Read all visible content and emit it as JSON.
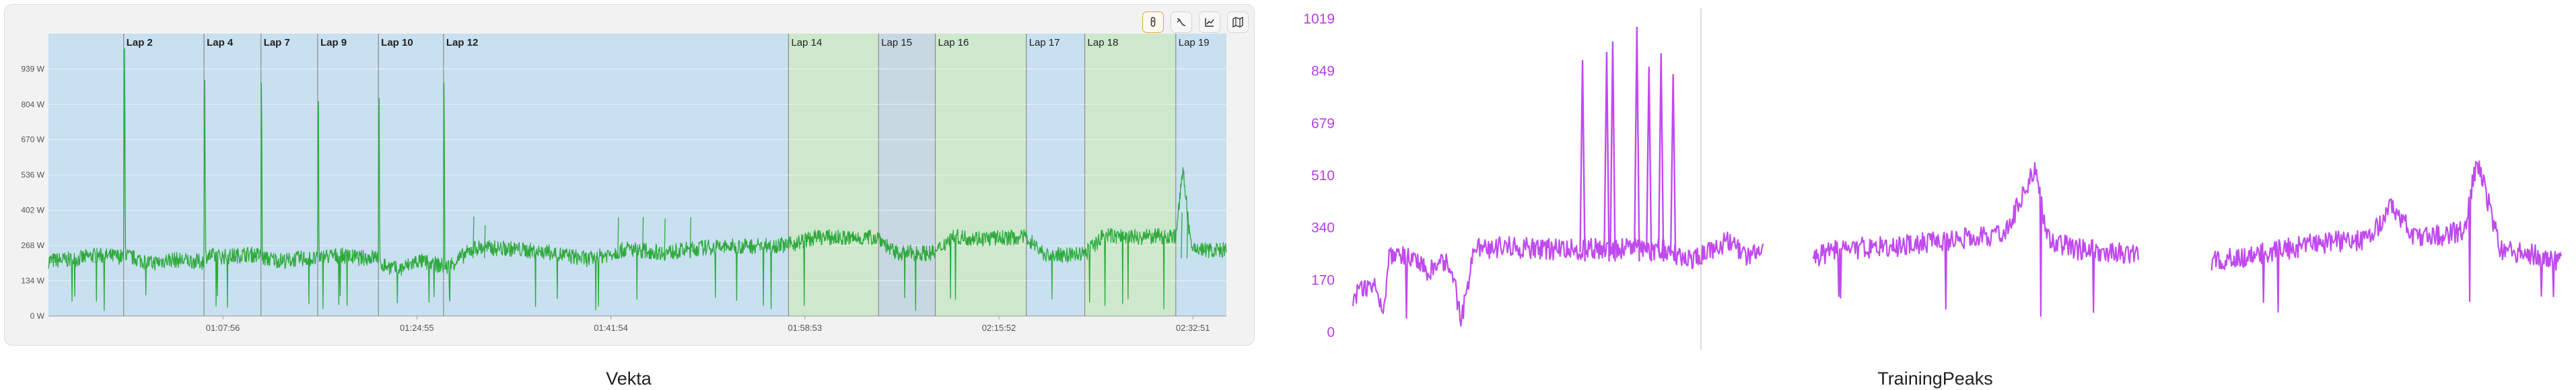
{
  "toolbar": {
    "buttons": [
      {
        "icon": "stopwatch-icon",
        "active": true
      },
      {
        "icon": "curve-icon",
        "active": false
      },
      {
        "icon": "line-chart-icon",
        "active": false
      },
      {
        "icon": "map-icon",
        "active": false
      }
    ]
  },
  "captions": {
    "vekta": "Vekta",
    "trainingpeaks": "TrainingPeaks"
  },
  "chart_data": [
    {
      "type": "line",
      "name": "vekta",
      "y_ticks": [
        "0 W",
        "134 W",
        "268 W",
        "402 W",
        "536 W",
        "670 W",
        "804 W",
        "939 W"
      ],
      "y_tick_values": [
        0,
        134,
        268,
        402,
        536,
        670,
        804,
        939
      ],
      "ylim": [
        0,
        1073
      ],
      "xlim": [
        3160,
        7860
      ],
      "x_ticks": [
        {
          "t": 4076,
          "label": "01:07:56"
        },
        {
          "t": 5095,
          "label": "01:24:55"
        },
        {
          "t": 6114,
          "label": "01:41:54"
        },
        {
          "t": 7133,
          "label": "01:58:53"
        },
        {
          "t": 8152,
          "label": "02:15:52"
        },
        {
          "t": 9171,
          "label": "02:32:51"
        }
      ],
      "grid": "horizontal",
      "colors": {
        "line": "#2eaa3c",
        "lap_blue": "#c8e0f0",
        "lap_green": "#cde8cd",
        "lap_gray": "#c8d8e2",
        "separator": "#8c8c8c"
      },
      "laps": [
        {
          "label": "Lap 2",
          "start": 3555,
          "end": 3560,
          "color": "blue",
          "bold": true
        },
        {
          "label": "Lap 4",
          "start": 3977,
          "end": 3982,
          "color": "blue",
          "bold": true
        },
        {
          "label": "Lap 7",
          "start": 4276,
          "end": 4281,
          "color": "blue",
          "bold": true
        },
        {
          "label": "Lap 9",
          "start": 4574,
          "end": 4579,
          "color": "blue",
          "bold": true
        },
        {
          "label": "Lap 10",
          "start": 4893,
          "end": 4898,
          "color": "blue",
          "bold": true
        },
        {
          "label": "Lap 12",
          "start": 5235,
          "end": 5240,
          "color": "blue",
          "bold": true
        },
        {
          "label": "Lap 14",
          "start": 7047,
          "end": 7520,
          "color": "green",
          "bold": false
        },
        {
          "label": "Lap 15",
          "start": 7520,
          "end": 7818,
          "color": "gray",
          "bold": false
        },
        {
          "label": "Lap 16",
          "start": 7818,
          "end": 8296,
          "color": "green",
          "bold": false
        },
        {
          "label": "Lap 17",
          "start": 8296,
          "end": 8603,
          "color": "blue",
          "bold": false
        },
        {
          "label": "Lap 18",
          "start": 8603,
          "end": 9081,
          "color": "green",
          "bold": false
        },
        {
          "label": "Lap 19",
          "start": 9081,
          "end": 9347,
          "color": "blue",
          "bold": false
        }
      ],
      "profile": [
        [
          3160,
          210
        ],
        [
          3300,
          215
        ],
        [
          3400,
          230
        ],
        [
          3555,
          225
        ],
        [
          3560,
          1040
        ],
        [
          3565,
          230
        ],
        [
          3700,
          200
        ],
        [
          3800,
          215
        ],
        [
          3900,
          210
        ],
        [
          3977,
          205
        ],
        [
          3980,
          1040
        ],
        [
          3985,
          230
        ],
        [
          4100,
          225
        ],
        [
          4200,
          235
        ],
        [
          4276,
          230
        ],
        [
          4279,
          1040
        ],
        [
          4283,
          220
        ],
        [
          4400,
          210
        ],
        [
          4500,
          220
        ],
        [
          4574,
          215
        ],
        [
          4577,
          1040
        ],
        [
          4581,
          225
        ],
        [
          4700,
          230
        ],
        [
          4800,
          220
        ],
        [
          4893,
          225
        ],
        [
          4896,
          1040
        ],
        [
          4900,
          200
        ],
        [
          5000,
          175
        ],
        [
          5100,
          210
        ],
        [
          5235,
          190
        ],
        [
          5238,
          1040
        ],
        [
          5242,
          180
        ],
        [
          5400,
          260
        ],
        [
          5600,
          255
        ],
        [
          5800,
          240
        ],
        [
          6000,
          215
        ],
        [
          6200,
          255
        ],
        [
          6400,
          240
        ],
        [
          6600,
          260
        ],
        [
          6800,
          265
        ],
        [
          7000,
          270
        ],
        [
          7047,
          270
        ],
        [
          7200,
          300
        ],
        [
          7400,
          295
        ],
        [
          7520,
          300
        ],
        [
          7600,
          240
        ],
        [
          7818,
          240
        ],
        [
          7900,
          300
        ],
        [
          8100,
          295
        ],
        [
          8296,
          300
        ],
        [
          8400,
          230
        ],
        [
          8603,
          235
        ],
        [
          8700,
          305
        ],
        [
          8900,
          300
        ],
        [
          9081,
          305
        ],
        [
          9120,
          560
        ],
        [
          9160,
          260
        ],
        [
          9250,
          250
        ],
        [
          9347,
          250
        ]
      ],
      "spikes": [
        5390,
        5450,
        6150,
        6280,
        6395,
        6530,
        9110,
        9140
      ]
    },
    {
      "type": "line",
      "name": "trainingpeaks",
      "y_ticks": [
        "0",
        "170",
        "340",
        "510",
        "679",
        "849",
        "1019"
      ],
      "y_tick_values": [
        0,
        170,
        340,
        510,
        679,
        849,
        1019
      ],
      "ylim": [
        0,
        1019
      ],
      "grid": "none",
      "marker_line_x": 0.288,
      "colors": {
        "line": "#c04aee",
        "tick_text": "#b83ee8",
        "marker": "#cfcfcf"
      },
      "profile": [
        [
          0.0,
          120
        ],
        [
          0.02,
          160
        ],
        [
          0.025,
          60
        ],
        [
          0.03,
          240
        ],
        [
          0.05,
          250
        ],
        [
          0.06,
          200
        ],
        [
          0.08,
          230
        ],
        [
          0.09,
          40
        ],
        [
          0.1,
          270
        ],
        [
          0.13,
          280
        ],
        [
          0.15,
          270
        ],
        [
          0.2,
          270
        ],
        [
          0.26,
          270
        ],
        [
          0.28,
          230
        ],
        [
          0.29,
          250
        ],
        [
          0.31,
          300
        ],
        [
          0.33,
          240
        ],
        [
          0.34,
          300
        ],
        [
          0.355,
          null
        ],
        [
          0.38,
          240
        ],
        [
          0.4,
          270
        ],
        [
          0.45,
          280
        ],
        [
          0.5,
          300
        ],
        [
          0.54,
          320
        ],
        [
          0.565,
          540
        ],
        [
          0.575,
          300
        ],
        [
          0.6,
          270
        ],
        [
          0.65,
          250
        ],
        [
          0.675,
          null
        ],
        [
          0.71,
          230
        ],
        [
          0.76,
          260
        ],
        [
          0.8,
          290
        ],
        [
          0.84,
          300
        ],
        [
          0.86,
          410
        ],
        [
          0.88,
          300
        ],
        [
          0.92,
          330
        ],
        [
          0.93,
          560
        ],
        [
          0.95,
          270
        ],
        [
          0.98,
          250
        ],
        [
          1.0,
          230
        ]
      ],
      "spikes": [
        0.19,
        0.215,
        0.21,
        0.235,
        0.245,
        0.255,
        0.265
      ]
    }
  ]
}
